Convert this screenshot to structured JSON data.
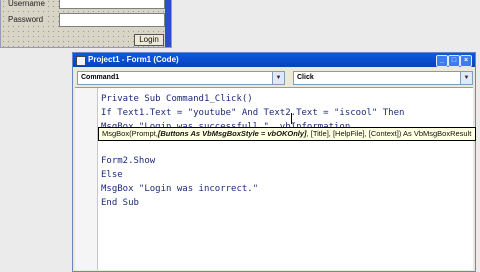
{
  "login_form": {
    "username_label": "Username",
    "password_label": "Password",
    "login_button": "Login"
  },
  "window": {
    "title": "Project1 - Form1 (Code)",
    "object_combo": "Command1",
    "procedure_combo": "Click"
  },
  "code_lines": [
    "Private Sub Command1_Click()",
    "If Text1.Text = \"youtube\" And Text2.Text = \"iscool\" Then",
    "MsgBox \"Login was successfull.\", vbInformation",
    "Form2.Show",
    "Else",
    "MsgBox \"Login was incorrect.\"",
    "End Sub"
  ],
  "tooltip": {
    "part1": "MsgBox(Prompt,",
    "part2": "[Buttons As VbMsgBoxStyle = vbOKOnly]",
    "part3": ", [Title], [HelpFile], [Context]) As VbMsgBoxResult"
  }
}
